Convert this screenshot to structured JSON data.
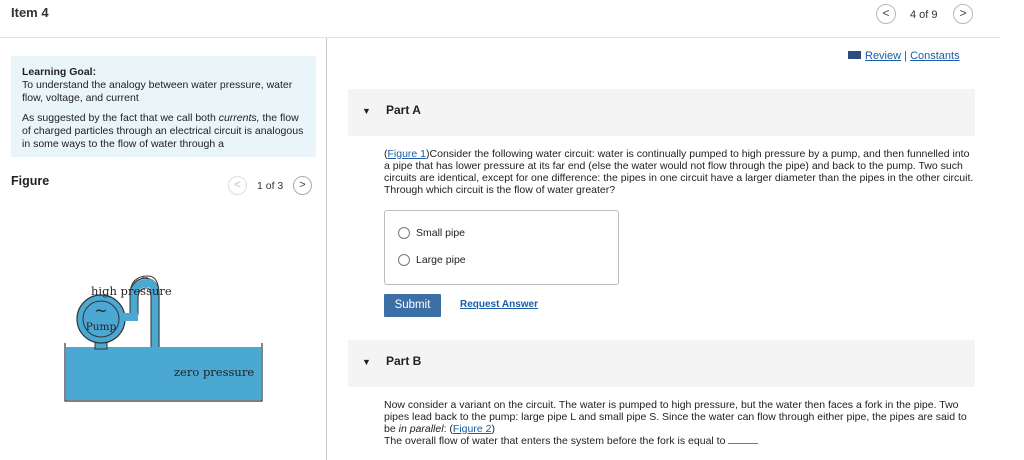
{
  "header": {
    "item_title": "Item 4",
    "nav_count": "4 of 9",
    "prev_glyph": "<",
    "next_glyph": ">"
  },
  "learning_goal": {
    "title": "Learning Goal:",
    "goal_text": "To understand the analogy between water pressure, water flow, voltage, and current",
    "intro_before": "As suggested by the fact that we call both ",
    "intro_emphasis": "currents,",
    "intro_after": " the flow of charged particles through an electrical circuit is analogous in some ways to the flow of water through a"
  },
  "figure": {
    "label": "Figure",
    "count": "1 of 3",
    "prev_glyph": "<",
    "next_glyph": ">",
    "labels": {
      "high_pressure": "high pressure",
      "zero_pressure": "zero pressure",
      "pump": "Pump",
      "pump_symbol": "~"
    },
    "colors": {
      "water": "#4aa8d2",
      "outline": "#333333"
    }
  },
  "toolbar": {
    "review": "Review",
    "separator": "|",
    "constants": "Constants"
  },
  "part_a": {
    "title": "Part A",
    "figure_link": "Figure 1",
    "question_open": "(",
    "question_text": ")Consider the following water circuit: water is continually pumped to high pressure by a pump, and then funnelled into a pipe that has lower pressure at its far end (else the water would not flow through the pipe) and back to the pump. Two such circuits are identical, except for one difference: the pipes in one circuit have a larger diameter than the pipes in the other circuit. Through which circuit is the flow of water greater?",
    "options": [
      {
        "label": "Small pipe"
      },
      {
        "label": "Large pipe"
      }
    ],
    "submit_label": "Submit",
    "request_answer_label": "Request Answer"
  },
  "part_b": {
    "title": "Part B",
    "text_1": "Now consider a variant on the circuit. The water is pumped to high pressure, but the water then faces a fork in the pipe. Two pipes lead back to the pump: large pipe L and small pipe S. Since the water can flow through either pipe, the pipes are said to be ",
    "text_emphasis": "in parallel",
    "text_2": ": (",
    "figure_link": "Figure 2",
    "text_3": ")",
    "text_4": "The overall flow of water that enters the system before the fork is equal to"
  },
  "colors": {
    "accent": "#3c6fa6",
    "link": "#1a5da8",
    "goal_bg": "#e9f5f9",
    "part_bg": "#f4f4f4"
  }
}
